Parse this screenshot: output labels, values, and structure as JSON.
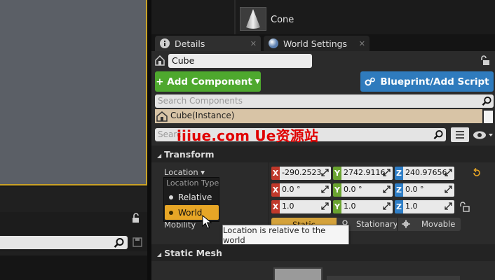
{
  "top_panel": {
    "item_label": "Cone"
  },
  "tabs": [
    {
      "label": "Details"
    },
    {
      "label": "World Settings"
    }
  ],
  "details": {
    "name_value": "Cube",
    "add_component_label": "+ Add Component",
    "blueprint_script_label": "Blueprint/Add Script",
    "search_components_placeholder": "Search Components",
    "instance_label": "Cube(Instance)",
    "search_details_placeholder": "Searc",
    "watermark": "iiiue.com  Ue资源站"
  },
  "transform": {
    "header": "Transform",
    "location_label": "Location ▾",
    "location_type_menu": {
      "title": "Location Type",
      "items": [
        "Relative",
        "World"
      ],
      "selected": "World"
    },
    "location": {
      "x": "-290.2523",
      "y": "2742.9116",
      "z": "240.97656"
    },
    "rotation": {
      "x": "0.0 °",
      "y": "0.0 °",
      "z": "0.0 °"
    },
    "scale": {
      "x": "1.0",
      "y": "1.0",
      "z": "1.0"
    },
    "mobility_label": "Mobility",
    "mobility_options": [
      "Static",
      "Stationary",
      "Movable"
    ],
    "mobility_selected": "Static",
    "tooltip": "Location is relative to the world"
  },
  "static_mesh": {
    "header": "Static Mesh"
  },
  "axis_labels": {
    "x": "X",
    "y": "Y",
    "z": "Z"
  },
  "colors": {
    "add_component": "#4ea82e",
    "blueprint": "#2f7bbd",
    "selection": "#e7a626",
    "axis_x": "#c0392b",
    "axis_y": "#6aa330",
    "axis_z": "#2f7ec6"
  }
}
